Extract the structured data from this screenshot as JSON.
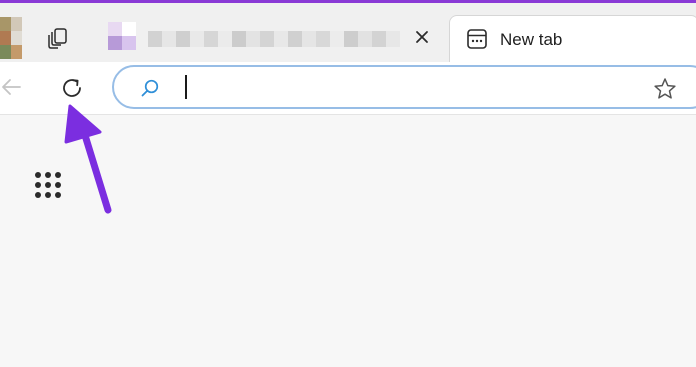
{
  "browser": {
    "accent_color": "#8a3ad6",
    "tabs": [
      {
        "title": "",
        "blurred_title": true,
        "favicon_colors": [
          "#e8d9f2",
          "#ffffff",
          "#b79ad8",
          "#d8c4ee"
        ],
        "title_blur_colors": [
          "#d2d2d2",
          "#e6e6e6",
          "#cfcfcf",
          "#e9e9e9",
          "#d6d6d6",
          "#ebebeb",
          "#cccccc",
          "#e3e3e3",
          "#d4d4d4",
          "#e8e8e8",
          "#d0d0d0",
          "#e5e5e5",
          "#d8d8d8",
          "#ececec",
          "#cdcdcd",
          "#e2e2e2",
          "#d3d3d3",
          "#e7e7e7"
        ],
        "close_label": "✕"
      },
      {
        "title": "New tab",
        "active": true,
        "icon": "new-tab-page-icon"
      }
    ],
    "profile_colors": [
      "#a89668",
      "#7a8a5a",
      "#b07a52",
      "#c49a6a",
      "#d2c8b8",
      "#e0dcd4"
    ],
    "workspaces_icon": "workspaces-icon"
  },
  "toolbar": {
    "back_icon": "back-arrow-icon",
    "refresh_icon": "refresh-icon",
    "address": {
      "value": "",
      "placeholder": "",
      "search_icon": "search-icon",
      "favorite_icon": "star-icon"
    }
  },
  "content": {
    "app_launcher_icon": "app-launcher-icon",
    "annotation": {
      "type": "arrow",
      "color": "#7b2ee0",
      "points_to": "refresh-button"
    }
  }
}
